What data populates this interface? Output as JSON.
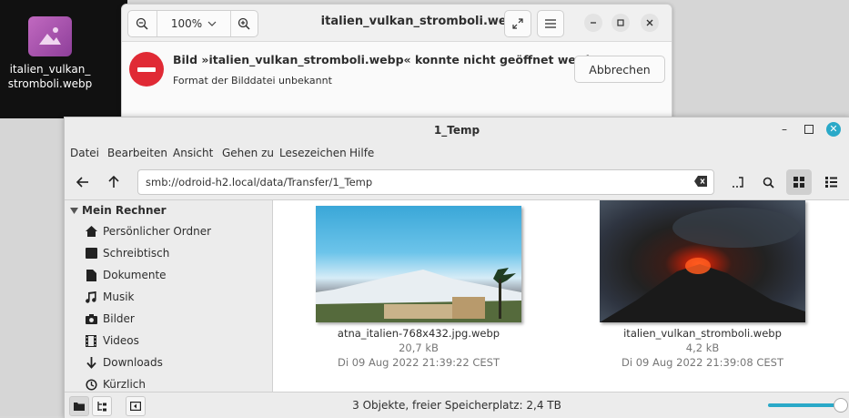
{
  "desktop": {
    "file_icon_label": "italien_vulkan_\nstromboli.webp"
  },
  "viewer": {
    "zoom": "100%",
    "title": "italien_vulkan_stromboli.webp",
    "error_title": "Bild »italien_vulkan_stromboli.webp« konnte nicht geöffnet werden.",
    "error_subtitle": "Format der Bilddatei unbekannt",
    "cancel_label": "Abbrechen"
  },
  "filemanager": {
    "title": "1_Temp",
    "menu": [
      "Datei",
      "Bearbeiten",
      "Ansicht",
      "Gehen zu",
      "Lesezeichen",
      "Hilfe"
    ],
    "path": "smb://odroid-h2.local/data/Transfer/1_Temp",
    "sidebar": {
      "header": "Mein Rechner",
      "items": [
        {
          "label": "Persönlicher Ordner",
          "icon": "home-icon"
        },
        {
          "label": "Schreibtisch",
          "icon": "desktop-icon"
        },
        {
          "label": "Dokumente",
          "icon": "document-icon"
        },
        {
          "label": "Musik",
          "icon": "music-icon"
        },
        {
          "label": "Bilder",
          "icon": "camera-icon"
        },
        {
          "label": "Videos",
          "icon": "film-icon"
        },
        {
          "label": "Downloads",
          "icon": "download-icon"
        },
        {
          "label": "Kürzlich",
          "icon": "recent-icon"
        }
      ]
    },
    "files": [
      {
        "name": "atna_italien-768x432.jpg.webp",
        "size": "20,7 kB",
        "date": "Di 09 Aug 2022 21:39:22 CEST"
      },
      {
        "name": "italien_vulkan_stromboli.webp",
        "size": "4,2 kB",
        "date": "Di 09 Aug 2022 21:39:08 CEST"
      }
    ],
    "status": "3 Objekte, freier Speicherplatz: 2,4 TB"
  },
  "colors": {
    "accent": "#2aa9c8",
    "error": "#e02a35"
  }
}
